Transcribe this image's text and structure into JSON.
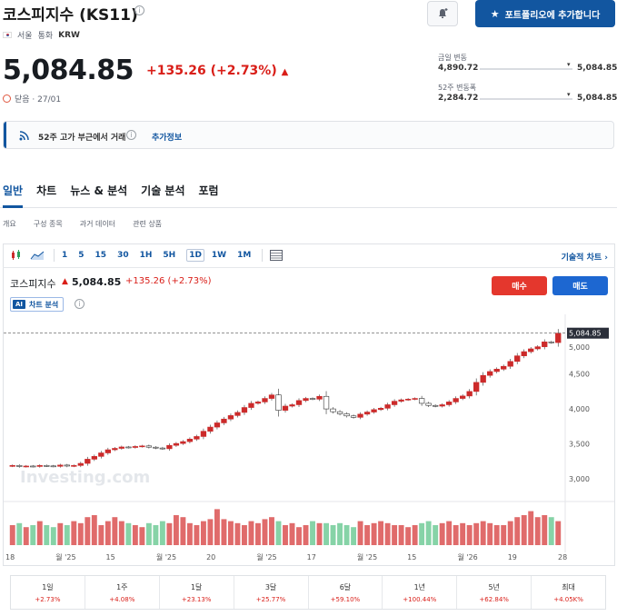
{
  "header": {
    "title": "코스피지수 (KS11)",
    "market": "서울",
    "currency_label": "통화",
    "currency": "KRW",
    "add_portfolio": "포트폴리오에 추가합니다"
  },
  "quote": {
    "price": "5,084.85",
    "change": "+135.26 (+2.73%)",
    "status": "닫음 · 27/01"
  },
  "ranges": {
    "day_label": "금일 변동",
    "day_low": "4,890.72",
    "day_high": "5,084.85",
    "week52_label": "52주 변동폭",
    "week52_low": "2,284.72",
    "week52_high": "5,084.85"
  },
  "banner": {
    "text": "52주 고가 부근에서 거래",
    "link": "추가정보"
  },
  "tabs": [
    "일반",
    "차트",
    "뉴스 & 분석",
    "기술 분석",
    "포럼"
  ],
  "subtabs": [
    "개요",
    "구성 종목",
    "과거 데이터",
    "관련 상품"
  ],
  "toolbar": {
    "intervals": [
      "1",
      "5",
      "15",
      "30",
      "1H",
      "5H",
      "1D",
      "1W",
      "1M"
    ],
    "selected": "1D",
    "tech_chart": "기술적 차트 ›"
  },
  "legend": {
    "name": "코스피지수",
    "price": "5,084.85",
    "change": "+135.26 (+2.73%)",
    "buy": "매수",
    "sell": "매도",
    "ai_badge": "AI",
    "ai_label": "차트 분석"
  },
  "colors": {
    "up": "#d91e18",
    "down": "#1256a0",
    "accent": "#1256a0",
    "candle_up": "#cc2a2a",
    "candle_down": "#5b8fc9",
    "volume_up": "#e06b6b",
    "volume_down": "#86d3a7"
  },
  "performance": [
    {
      "label": "1일",
      "value": "+2.73%"
    },
    {
      "label": "1주",
      "value": "+4.08%"
    },
    {
      "label": "1달",
      "value": "+23.13%"
    },
    {
      "label": "3달",
      "value": "+25.77%"
    },
    {
      "label": "6달",
      "value": "+59.10%"
    },
    {
      "label": "1년",
      "value": "+100.44%"
    },
    {
      "label": "5년",
      "value": "+62.84%"
    },
    {
      "label": "최대",
      "value": "+4.05K%"
    }
  ],
  "chart_data": {
    "type": "candlestick",
    "ylabels": [
      "3,000",
      "3,500",
      "4,000",
      "4,500",
      "5,000"
    ],
    "yticks": [
      3000,
      3500,
      4000,
      4500,
      5000
    ],
    "ylim": [
      2700,
      5250
    ],
    "xlabels": [
      "18",
      "월 '25",
      "15",
      "월 '25",
      "20",
      "월 '25",
      "17",
      "월 '25",
      "15",
      "월 '26",
      "19",
      "28"
    ],
    "last_label": "5,084.85",
    "last_value": 5084.85,
    "closes": [
      3190,
      3175,
      3182,
      3176,
      3190,
      3184,
      3178,
      3196,
      3182,
      3190,
      3220,
      3280,
      3320,
      3370,
      3415,
      3435,
      3455,
      3448,
      3462,
      3470,
      3452,
      3440,
      3430,
      3478,
      3505,
      3532,
      3568,
      3605,
      3680,
      3740,
      3800,
      3855,
      3905,
      3950,
      4020,
      4080,
      4100,
      4150,
      4200,
      3980,
      4040,
      4060,
      4120,
      4150,
      4140,
      4180,
      4000,
      3960,
      3930,
      3900,
      3880,
      3925,
      3955,
      3990,
      4010,
      4060,
      4110,
      4130,
      4140,
      4150,
      4080,
      4050,
      4040,
      4060,
      4100,
      4150,
      4185,
      4250,
      4380,
      4480,
      4535,
      4570,
      4610,
      4680,
      4760,
      4820,
      4860,
      4890,
      4960,
      4950,
      5084.85
    ],
    "volumes": [
      0.5,
      0.55,
      0.45,
      0.5,
      0.6,
      0.5,
      0.45,
      0.55,
      0.5,
      0.6,
      0.55,
      0.7,
      0.75,
      0.5,
      0.6,
      0.7,
      0.6,
      0.55,
      0.5,
      0.45,
      0.55,
      0.5,
      0.6,
      0.55,
      0.75,
      0.7,
      0.55,
      0.5,
      0.6,
      0.65,
      0.9,
      0.65,
      0.6,
      0.55,
      0.5,
      0.6,
      0.55,
      0.65,
      0.7,
      0.6,
      0.5,
      0.55,
      0.45,
      0.5,
      0.6,
      0.55,
      0.55,
      0.5,
      0.55,
      0.5,
      0.45,
      0.6,
      0.5,
      0.55,
      0.6,
      0.55,
      0.5,
      0.5,
      0.45,
      0.5,
      0.55,
      0.6,
      0.5,
      0.55,
      0.6,
      0.5,
      0.55,
      0.5,
      0.55,
      0.6,
      0.55,
      0.5,
      0.5,
      0.6,
      0.7,
      0.75,
      0.85,
      0.7,
      0.75,
      0.7,
      0.6
    ],
    "watermark": "Investing.com"
  }
}
